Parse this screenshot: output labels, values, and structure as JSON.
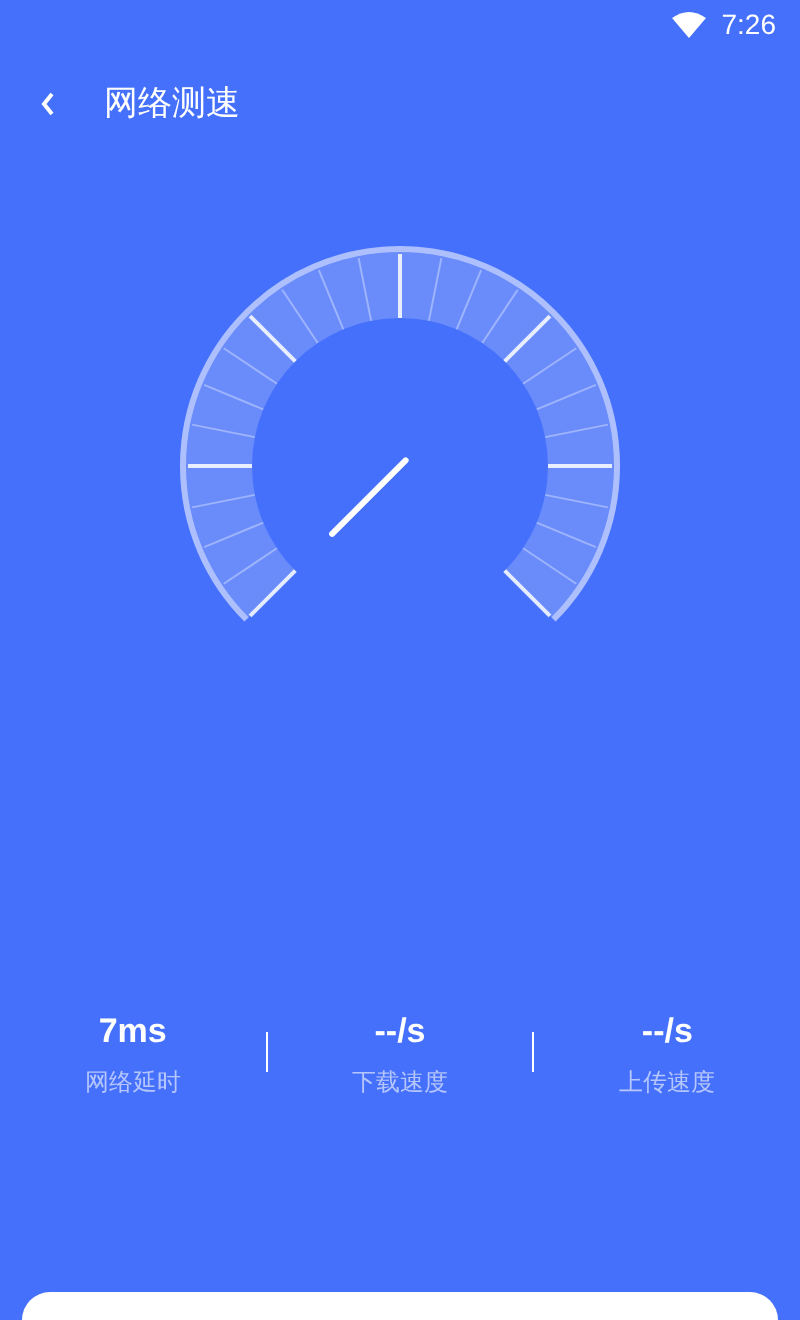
{
  "status_bar": {
    "time": "7:26"
  },
  "header": {
    "title": "网络测速"
  },
  "stats": [
    {
      "value": "7ms",
      "label": "网络延时"
    },
    {
      "value": "--/s",
      "label": "下载速度"
    },
    {
      "value": "--/s",
      "label": "上传速度"
    }
  ]
}
